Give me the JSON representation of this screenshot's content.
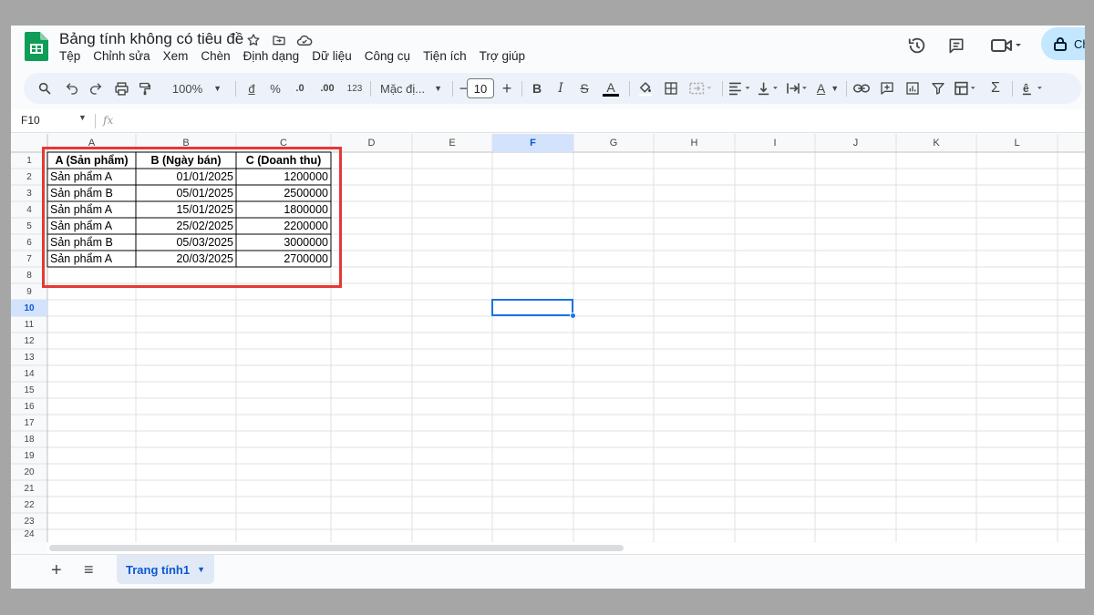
{
  "app": {
    "title": "Bảng tính không có tiêu đề",
    "menu": [
      "Tệp",
      "Chỉnh sửa",
      "Xem",
      "Chèn",
      "Định dạng",
      "Dữ liệu",
      "Công cụ",
      "Tiện ích",
      "Trợ giúp"
    ],
    "share_label": "Ch",
    "accent": "#0f9d58"
  },
  "toolbar": {
    "zoom": "100%",
    "currency": "đ",
    "percent": "%",
    "dec_decrease": ".0",
    "dec_increase": ".00",
    "number_format": "123",
    "font": "Mặc đị...",
    "font_size": "10",
    "bold": "B",
    "italic": "I",
    "strike": "S",
    "text_color": "A",
    "text_rotation": "A",
    "function": "Σ"
  },
  "formula_bar": {
    "name_box": "F10",
    "fx": "fx"
  },
  "grid": {
    "columns": [
      "A",
      "B",
      "C",
      "D",
      "E",
      "F",
      "G",
      "H",
      "I",
      "J",
      "K",
      "L"
    ],
    "rows": [
      "1",
      "2",
      "3",
      "4",
      "5",
      "6",
      "7",
      "8",
      "9",
      "10",
      "11",
      "12",
      "13",
      "14",
      "15",
      "16",
      "17",
      "18",
      "19",
      "20",
      "21",
      "22",
      "23",
      "24"
    ],
    "active_cell": "F10",
    "header_row": [
      "A (Sản phẩm)",
      "B (Ngày bán)",
      "C (Doanh thu)"
    ],
    "data": [
      [
        "Sản phẩm A",
        "01/01/2025",
        "1200000"
      ],
      [
        "Sản phẩm B",
        "05/01/2025",
        "2500000"
      ],
      [
        "Sản phẩm A",
        "15/01/2025",
        "1800000"
      ],
      [
        "Sản phẩm A",
        "25/02/2025",
        "2200000"
      ],
      [
        "Sản phẩm B",
        "05/03/2025",
        "3000000"
      ],
      [
        "Sản phẩm A",
        "20/03/2025",
        "2700000"
      ]
    ],
    "highlight_color": "#e53935",
    "selection_color": "#1a73e8"
  },
  "sheets": {
    "tabs": [
      "Trang tính1"
    ]
  }
}
